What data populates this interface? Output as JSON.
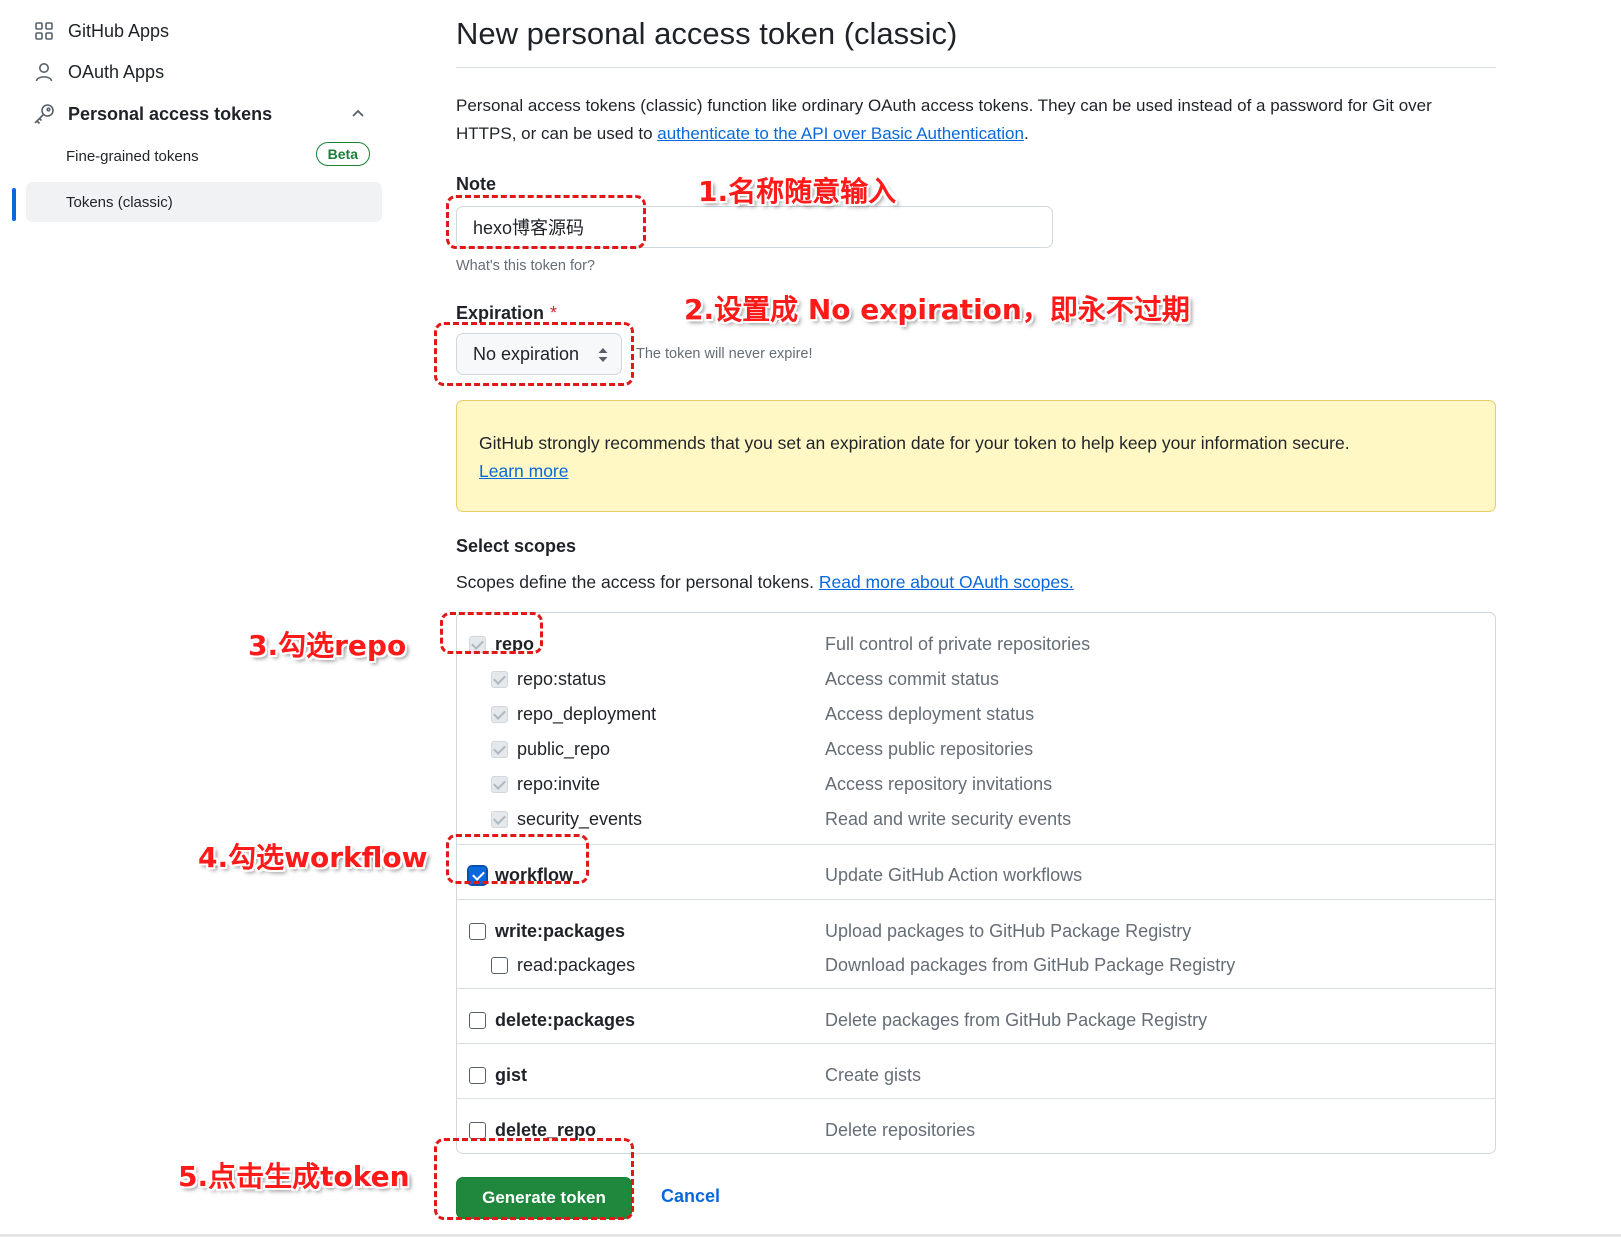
{
  "sidebar": {
    "github_apps": "GitHub Apps",
    "oauth_apps": "OAuth Apps",
    "personal_tokens": "Personal access tokens",
    "fine_grained": "Fine-grained tokens",
    "beta_badge": "Beta",
    "tokens_classic": "Tokens (classic)"
  },
  "page": {
    "title": "New personal access token (classic)",
    "intro_text": "Personal access tokens (classic) function like ordinary OAuth access tokens. They can be used instead of a password for Git over HTTPS, or can be used to ",
    "intro_link": "authenticate to the API over Basic Authentication",
    "intro_end": "."
  },
  "note": {
    "label": "Note",
    "value": "hexo博客源码",
    "hint": "What's this token for?"
  },
  "expiration": {
    "label": "Expiration",
    "required_mark": "*",
    "selected": "No expiration",
    "hint": "The token will never expire!"
  },
  "warning": {
    "text": "GitHub strongly recommends that you set an expiration date for your token to help keep your information secure.",
    "link": "Learn more"
  },
  "scopes": {
    "heading": "Select scopes",
    "desc": "Scopes define the access for personal tokens. ",
    "desc_link": "Read more about OAuth scopes.",
    "items": [
      {
        "name": "repo",
        "desc": "Full control of private repositories",
        "state": "disabled"
      },
      {
        "name": "repo:status",
        "desc": "Access commit status",
        "state": "disabled"
      },
      {
        "name": "repo_deployment",
        "desc": "Access deployment status",
        "state": "disabled"
      },
      {
        "name": "public_repo",
        "desc": "Access public repositories",
        "state": "disabled"
      },
      {
        "name": "repo:invite",
        "desc": "Access repository invitations",
        "state": "disabled"
      },
      {
        "name": "security_events",
        "desc": "Read and write security events",
        "state": "disabled"
      },
      {
        "name": "workflow",
        "desc": "Update GitHub Action workflows",
        "state": "checked"
      },
      {
        "name": "write:packages",
        "desc": "Upload packages to GitHub Package Registry",
        "state": "unchecked"
      },
      {
        "name": "read:packages",
        "desc": "Download packages from GitHub Package Registry",
        "state": "unchecked"
      },
      {
        "name": "delete:packages",
        "desc": "Delete packages from GitHub Package Registry",
        "state": "unchecked"
      },
      {
        "name": "gist",
        "desc": "Create gists",
        "state": "unchecked"
      },
      {
        "name": "delete_repo",
        "desc": "Delete repositories",
        "state": "unchecked"
      }
    ]
  },
  "actions": {
    "generate": "Generate token",
    "cancel": "Cancel"
  },
  "annotations": {
    "a1": "1.名称随意输入",
    "a2": "2.设置成 No expiration，即永不过期",
    "a3": "3.勾选repo",
    "a4": "4.勾选workflow",
    "a5": "5.点击生成token"
  },
  "colors": {
    "accent": "#0969da",
    "success": "#1f883d",
    "annotation": "#ff1a1a",
    "warning_bg": "#fff8c5"
  }
}
